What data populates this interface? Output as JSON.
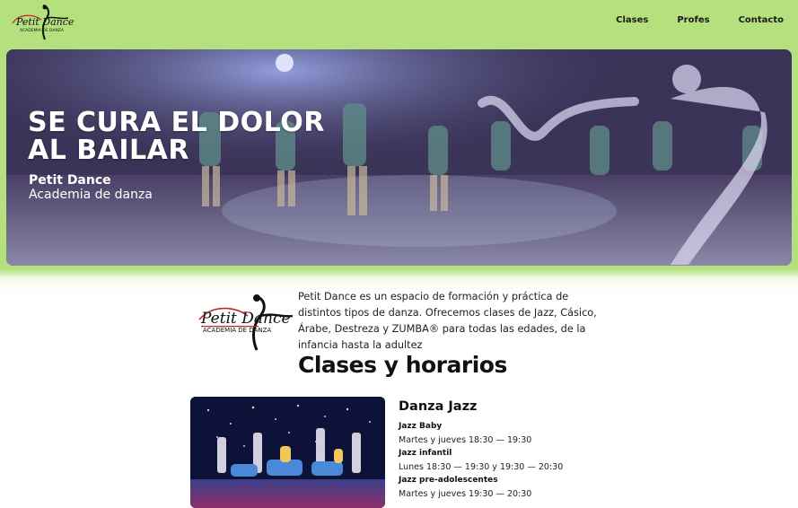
{
  "header": {
    "logo": {
      "brand": "Petit Dance",
      "tagline": "ACADEMIA DE DANZA",
      "icon": "dancer-logo-icon"
    },
    "nav": [
      {
        "label": "Clases"
      },
      {
        "label": "Profes"
      },
      {
        "label": "Contacto"
      }
    ]
  },
  "hero": {
    "title_line1": "SE CURA EL DOLOR",
    "title_line2": "AL BAILAR",
    "brand": "Petit Dance",
    "subtitle": "Academia de danza"
  },
  "about": {
    "logo": {
      "brand": "Petit Dance",
      "tagline": "ACADEMIA DE DANZA"
    },
    "text": "Petit Dance es un espacio de formación y práctica de distintos tipos de danza. Ofrecemos clases de Jazz, Cásico, Árabe, Destreza y ZUMBA® para todas las edades, de la infancia hasta la adultez"
  },
  "classes": {
    "title": "Clases y horarios",
    "items": [
      {
        "name": "Danza Jazz",
        "groups": [
          {
            "name": "Jazz Baby",
            "time": "Martes y jueves 18:30 — 19:30"
          },
          {
            "name": "Jazz infantil",
            "time": "Lunes 18:30 — 19:30 y 19:30 — 20:30"
          },
          {
            "name": "Jazz pre-adolescentes",
            "time": "Martes y jueves 19:30 — 20:30"
          }
        ]
      }
    ]
  },
  "colors": {
    "header_bg": "#b5e07e",
    "text": "#111111",
    "logo_red": "#c0242a"
  }
}
